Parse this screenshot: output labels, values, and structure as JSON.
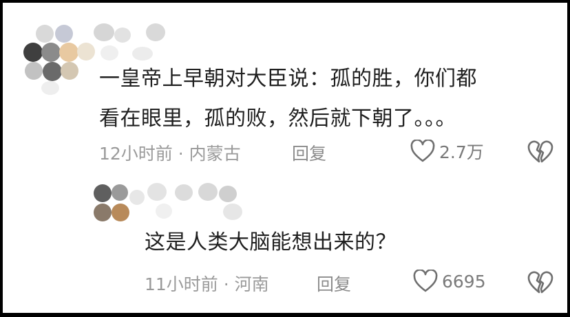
{
  "comments": [
    {
      "text_lines": [
        "一皇帝上早朝对大臣说：孤的胜，你们都",
        "看在眼里，孤的败，然后就下朝了。。。"
      ],
      "meta": "12小时前 · 内蒙古",
      "reply_label": "回复",
      "like_count": "2.7万"
    },
    {
      "text_lines": [
        "这是人类大脑能想出来的？"
      ],
      "meta": "11小时前 · 河南",
      "reply_label": "回复",
      "like_count": "6695"
    }
  ],
  "icons": {
    "like": "heart-outline-icon",
    "dislike": "broken-heart-icon"
  },
  "colors": {
    "text": "#1f1f1f",
    "meta": "#9a9a9a",
    "icon": "#6e6e6e"
  }
}
